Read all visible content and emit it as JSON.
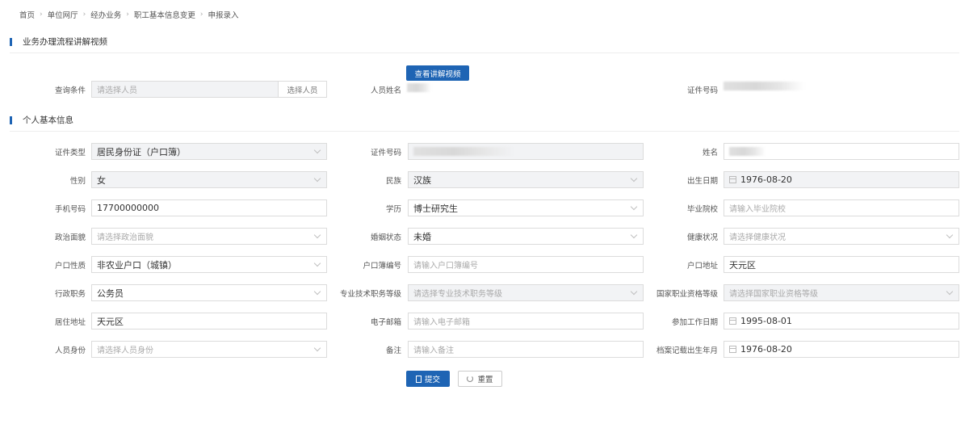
{
  "breadcrumb": [
    "首页",
    "单位网厅",
    "经办业务",
    "职工基本信息变更",
    "申报录入"
  ],
  "sections": {
    "video": "业务办理流程讲解视频",
    "basic": "个人基本信息"
  },
  "video_button": "查看讲解视频",
  "query": {
    "label": "查询条件",
    "placeholder": "请选择人员",
    "select_button": "选择人员",
    "person_name_label": "人员姓名",
    "id_number_label": "证件号码"
  },
  "form": {
    "id_type": {
      "label": "证件类型",
      "value": "居民身份证（户口簿）"
    },
    "id_number": {
      "label": "证件号码",
      "value": ""
    },
    "name": {
      "label": "姓名",
      "value": ""
    },
    "gender": {
      "label": "性别",
      "value": "女"
    },
    "ethnicity": {
      "label": "民族",
      "value": "汉族"
    },
    "birth_date": {
      "label": "出生日期",
      "value": "1976-08-20"
    },
    "phone": {
      "label": "手机号码",
      "value": "17700000000"
    },
    "education": {
      "label": "学历",
      "value": "博士研究生"
    },
    "school": {
      "label": "毕业院校",
      "placeholder": "请输入毕业院校"
    },
    "political": {
      "label": "政治面貌",
      "placeholder": "请选择政治面貌"
    },
    "marital": {
      "label": "婚姻状态",
      "value": "未婚"
    },
    "health": {
      "label": "健康状况",
      "placeholder": "请选择健康状况"
    },
    "hukou_type": {
      "label": "户口性质",
      "value": "非农业户口（城镇）"
    },
    "hukou_no": {
      "label": "户口簿编号",
      "placeholder": "请输入户口簿编号"
    },
    "hukou_addr": {
      "label": "户口地址",
      "value": "天元区"
    },
    "admin_post": {
      "label": "行政职务",
      "value": "公务员"
    },
    "tech_level": {
      "label": "专业技术职务等级",
      "placeholder": "请选择专业技术职务等级"
    },
    "national_level": {
      "label": "国家职业资格等级",
      "placeholder": "请选择国家职业资格等级"
    },
    "residence": {
      "label": "居住地址",
      "value": "天元区"
    },
    "email": {
      "label": "电子邮箱",
      "placeholder": "请输入电子邮箱"
    },
    "work_start": {
      "label": "参加工作日期",
      "value": "1995-08-01"
    },
    "identity": {
      "label": "人员身份",
      "placeholder": "请选择人员身份"
    },
    "remark": {
      "label": "备注",
      "placeholder": "请输入备注"
    },
    "archive_birth": {
      "label": "档案记载出生年月",
      "value": "1976-08-20"
    }
  },
  "actions": {
    "submit": "提交",
    "reset": "重置"
  },
  "colors": {
    "primary": "#1e64b4"
  }
}
